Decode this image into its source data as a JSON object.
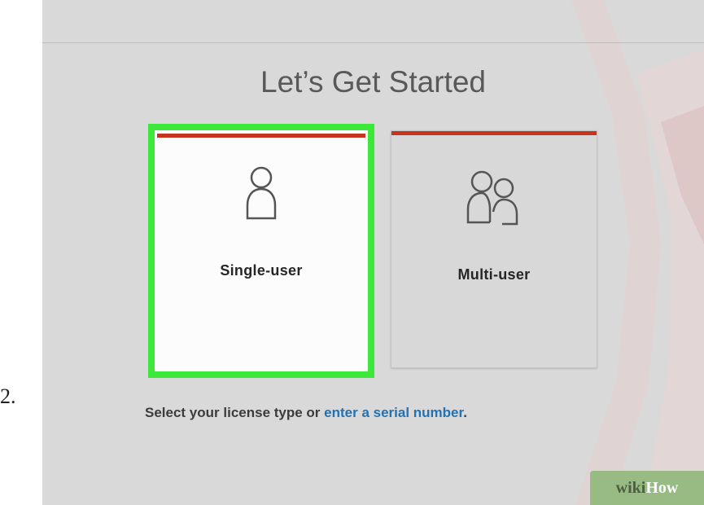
{
  "step_number": "2.",
  "dialog": {
    "title": "Let’s Get Started",
    "options": [
      {
        "label": "Single-user",
        "icon": "single-user-icon",
        "selected": true
      },
      {
        "label": "Multi-user",
        "icon": "multi-user-icon",
        "selected": false
      }
    ],
    "footer": {
      "prefix": "Select your license type or ",
      "link": "enter a serial number",
      "suffix": "."
    }
  },
  "watermark": {
    "part1": "wiki",
    "part2": "How"
  },
  "colors": {
    "accent_bar": "#c7341e",
    "selection_highlight": "#3ee83b",
    "link": "#2272b4",
    "background": "#d9d9d9"
  }
}
